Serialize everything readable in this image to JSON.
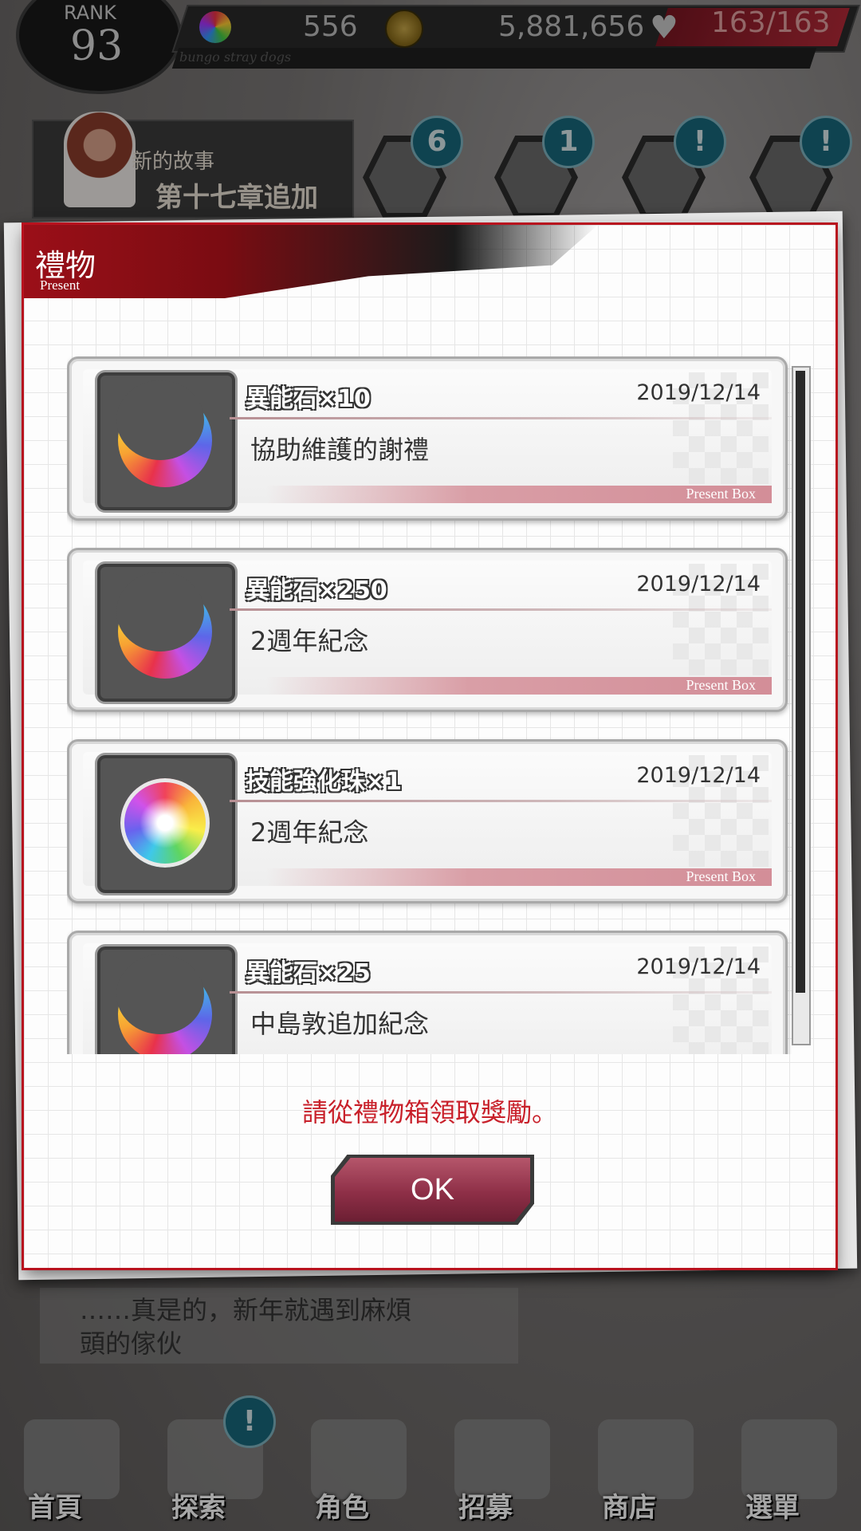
{
  "topbar": {
    "rank_label": "RANK",
    "rank_value": "93",
    "stones": "556",
    "coins": "5,881,656",
    "hp": "163/163",
    "sub_text": "bungo stray dogs"
  },
  "background": {
    "story_new": "新的故事",
    "story_chapter": "第十七章追加",
    "badges": [
      "6",
      "1",
      "!",
      "!"
    ],
    "dialogue_line1": "……真是的，新年就遇到麻煩",
    "dialogue_line2": "頭的傢伙",
    "nav": [
      "首頁",
      "探索",
      "角色",
      "招募",
      "商店",
      "選單"
    ],
    "nav_badge": "!"
  },
  "dialog": {
    "title": "禮物",
    "subtitle": "Present",
    "footer_label": "Present Box",
    "notice": "請從禮物箱領取獎勵。",
    "ok_label": "OK",
    "items": [
      {
        "title": "異能石×10",
        "date": "2019/12/14",
        "desc": "協助維護的謝禮",
        "icon": "ability-stone-icon"
      },
      {
        "title": "異能石×250",
        "date": "2019/12/14",
        "desc": "2週年紀念",
        "icon": "ability-stone-icon"
      },
      {
        "title": "技能強化珠×1",
        "date": "2019/12/14",
        "desc": "2週年紀念",
        "icon": "skill-orb-icon"
      },
      {
        "title": "異能石×25",
        "date": "2019/12/14",
        "desc": "中島敦追加紀念",
        "icon": "ability-stone-icon"
      }
    ]
  },
  "colors": {
    "accent_red": "#c8202a",
    "title_red": "#9b0f18",
    "ok_button": "#8e2f47"
  }
}
